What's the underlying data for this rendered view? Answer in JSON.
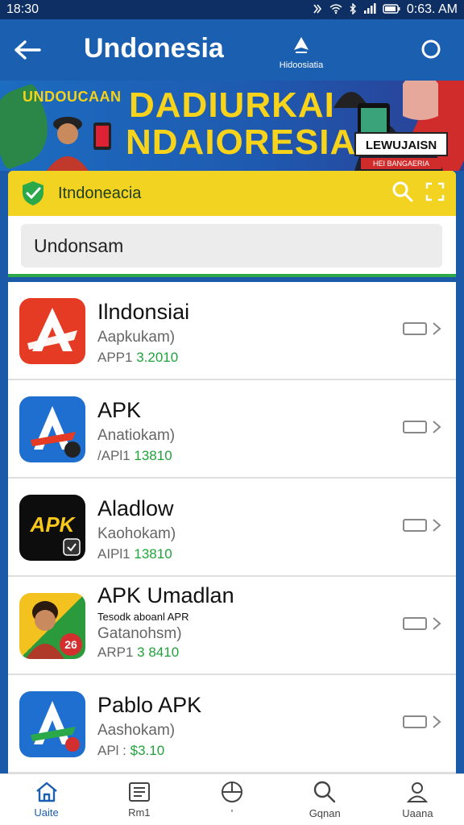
{
  "status_bar": {
    "time": "18:30",
    "clock": "0:63. AM",
    "icons": [
      "nfc-icon",
      "wifi-icon",
      "bluetooth-icon",
      "signal-icon",
      "battery-icon"
    ]
  },
  "app_bar": {
    "title": "Undonesia",
    "brand_text": "Hidoosiatia"
  },
  "banner": {
    "kicker": "UNDOUCAAN",
    "headline_line1": "DADIURKAI",
    "headline_line2": "NDAIORESIA",
    "tag": "LEWUJAISN",
    "tag_sub": "HEI BANGAERIA"
  },
  "panel": {
    "title": "Itndoneacia",
    "search_value": "Undonsam"
  },
  "apps": [
    {
      "title": "Ilndonsiai",
      "tagline": "",
      "subtitle": "Aapkukam)",
      "size_prefix": "APP1",
      "size_value": "3.2010"
    },
    {
      "title": "APK",
      "tagline": "",
      "subtitle": "Anatiokam)",
      "size_prefix": "/APl1",
      "size_value": "13810"
    },
    {
      "title": "Aladlow",
      "tagline": "",
      "subtitle": "Kaohokam)",
      "size_prefix": "AIPl1",
      "size_value": "13810"
    },
    {
      "title": "APK Umadlan",
      "tagline": "Tesodk aboanl APR",
      "subtitle": "Gatanohsm)",
      "size_prefix": "ARP1",
      "size_value": "3 8410"
    },
    {
      "title": "Pablo APK",
      "tagline": "",
      "subtitle": "Aashokam)",
      "size_prefix": "APl :",
      "size_value": "$3.10"
    }
  ],
  "icon_labels": {
    "apk_badge": "APK",
    "umadlan_badge": "26"
  },
  "bottom_nav": [
    {
      "label": "Uaite",
      "icon": "home-icon"
    },
    {
      "label": "Rm1",
      "icon": "list-icon"
    },
    {
      "label": "'",
      "icon": "compass-icon"
    },
    {
      "label": "Gqnan",
      "icon": "search-icon"
    },
    {
      "label": "Uaana",
      "icon": "profile-icon"
    }
  ],
  "colors": {
    "app_bar": "#1b5fb0",
    "panel_header": "#f3d322",
    "accent_green": "#2aa84a",
    "banner_text": "#f7d31b"
  }
}
